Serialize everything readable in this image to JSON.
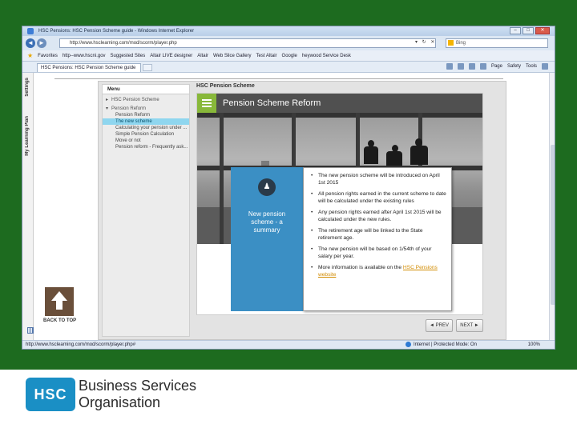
{
  "browser": {
    "window_title": "HSC Pensions: HSC Pension Scheme guide - Windows Internet Explorer",
    "address": "http://www.hsclearning.com/mod/scorm/player.php",
    "search_placeholder": "Bing",
    "favorites_label": "Favorites",
    "favorites": [
      "http--www.hscni.gov",
      "Suggested Sites",
      "Altair LIVE designer",
      "Altair",
      "Web Slice Gallery",
      "Test Altair",
      "Google",
      "heywood Service Desk"
    ],
    "tab_label": "HSC Pensions: HSC Pension Scheme guide",
    "commands": [
      "Page",
      "Safety",
      "Tools"
    ],
    "status_url": "http://www.hsclearning.com/mod/scorm/player.php#",
    "status_zone": "Internet | Protected Mode: On",
    "zoom": "100%"
  },
  "sidebar_tabs": [
    "Settings",
    "My Learning Plan"
  ],
  "player": {
    "menu_title": "Menu",
    "menu_items": [
      {
        "label": "HSC Pension Scheme",
        "level": "top",
        "marker": "▸",
        "active": false
      },
      {
        "label": "Pension Reform",
        "level": "top",
        "marker": "▾",
        "active": false
      },
      {
        "label": "Pension Reform",
        "level": "sub",
        "marker": "",
        "active": false
      },
      {
        "label": "The new scheme",
        "level": "sub",
        "marker": "",
        "active": true
      },
      {
        "label": "Calculating your pension under ...",
        "level": "sub",
        "marker": "",
        "active": false
      },
      {
        "label": "Simple Pension Calculation",
        "level": "sub",
        "marker": "",
        "active": false
      },
      {
        "label": "Move or not",
        "level": "sub",
        "marker": "",
        "active": false
      },
      {
        "label": "Pension reform - Frequently ask...",
        "level": "sub",
        "marker": "",
        "active": false
      }
    ],
    "course_title": "HSC Pension Scheme",
    "slide_title": "Pension Scheme Reform",
    "summary_text": "New pension scheme - a summary",
    "bullets": [
      "The new pension scheme will be introduced on April 1st 2015",
      "All pension rights earned in the current scheme to date will be calculated under the existing rules",
      "Any pension rights earned after April 1st 2015 will be calculated under the new rules.",
      "The retirement age will be linked to the State retirement age.",
      "The new pension will be based on 1/54th of your salary per year."
    ],
    "last_bullet_prefix": "More information is available on the ",
    "last_bullet_link": "HSC Pensions website",
    "prev_label": "◄ PREV",
    "next_label": "NEXT ►",
    "back_to_top_label": "BACK TO TOP"
  },
  "footer": {
    "logo_text": "HSC",
    "org_line1": "Business Services",
    "org_line2": "Organisation"
  },
  "colors": {
    "frame_green": "#1d6b1f",
    "accent_green": "#88b83a",
    "summary_blue": "#3b8fc4",
    "active_menu": "#8fd6ef",
    "back_to_top_brown": "#6a4f3a",
    "hsc_blue": "#1a8fc5"
  }
}
